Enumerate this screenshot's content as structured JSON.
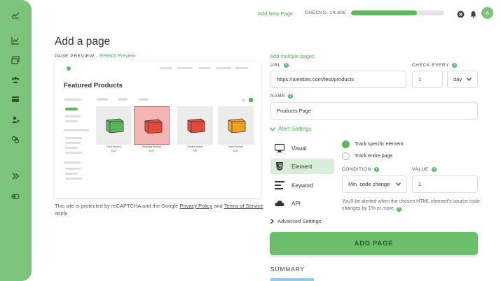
{
  "topbar": {
    "add_new_page": "Add New Page",
    "checks_label": "CHECKS: 14,805",
    "checks_progress_percent": 71,
    "avatar_initial": "A"
  },
  "sidebar": {
    "logo": "alertbits-logo-icon",
    "items": [
      "chart-icon",
      "monitors-icon",
      "team-icon",
      "billing-icon",
      "user-settings-icon",
      "integrations-icon",
      "expand-icon",
      "toggle-icon"
    ]
  },
  "page": {
    "title": "Add a page"
  },
  "preview": {
    "label": "PAGE PREVIEW",
    "separator": "-",
    "refetch": "Refetch Preview",
    "heading": "Featured Products",
    "products": [
      {
        "name": "Card Product",
        "price": "$165",
        "color": "#5cb85c",
        "selected": false
      },
      {
        "name": "Amazing Product",
        "price": "$299",
        "color": "#e74c3c",
        "selected": true
      },
      {
        "name": "Great Product",
        "price": "$99",
        "color": "#e74c3c",
        "selected": false
      },
      {
        "name": "New Product",
        "price": "$185",
        "color": "#f5a623",
        "selected": false
      }
    ]
  },
  "recaptcha": {
    "prefix": "This site is protected by reCAPTCHA and the Google",
    "privacy": "Privacy Policy",
    "and": "and",
    "terms": "Terms of Service",
    "suffix": "apply."
  },
  "form": {
    "multiple_link": "Add multiple pages",
    "url_label": "URL",
    "url_value": "https://alertbits.com/test/products",
    "check_every_label": "CHECK EVERY",
    "check_every_value": "1",
    "check_every_unit": "day",
    "name_label": "NAME",
    "name_value": "Products Page",
    "alert_settings": "Alert Settings",
    "types": [
      {
        "label": "Visual",
        "icon": "monitor-icon",
        "active": false
      },
      {
        "label": "Element",
        "icon": "html5-icon",
        "active": true
      },
      {
        "label": "Keyword",
        "icon": "keyword-icon",
        "active": false
      },
      {
        "label": "API",
        "icon": "cloud-icon",
        "active": false
      }
    ],
    "track_specific": "Track specific element",
    "track_entire": "Track entire page",
    "condition_label": "CONDITION",
    "condition_value": "Min. code change",
    "value_label": "VALUE",
    "value_value": "1",
    "hint": "You'll be alerted when the chosen HTML element's source code changes by 1% or more.",
    "advanced": "Advanced Settings",
    "submit": "ADD PAGE",
    "summary": "SUMMARY"
  },
  "colors": {
    "accent": "#5cb85c",
    "sidebar": "#7cc47c",
    "button": "#6bbf6b"
  }
}
